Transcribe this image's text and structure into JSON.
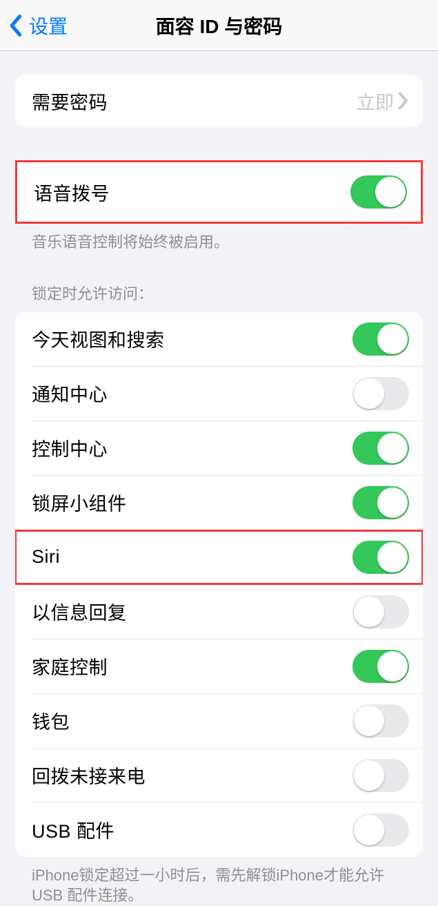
{
  "header": {
    "back_label": "设置",
    "title": "面容 ID 与密码"
  },
  "require_passcode": {
    "label": "需要密码",
    "value": "立即"
  },
  "voice_dial": {
    "label": "语音拨号",
    "on": true,
    "footer": "音乐语音控制将始终被启用。"
  },
  "lock_access_header": "锁定时允许访问：",
  "lock_access_items": [
    {
      "label": "今天视图和搜索",
      "on": true,
      "highlighted": false
    },
    {
      "label": "通知中心",
      "on": false,
      "highlighted": false
    },
    {
      "label": "控制中心",
      "on": true,
      "highlighted": false
    },
    {
      "label": "锁屏小组件",
      "on": true,
      "highlighted": false
    },
    {
      "label": "Siri",
      "on": true,
      "highlighted": true
    },
    {
      "label": "以信息回复",
      "on": false,
      "highlighted": false
    },
    {
      "label": "家庭控制",
      "on": true,
      "highlighted": false
    },
    {
      "label": "钱包",
      "on": false,
      "highlighted": false
    },
    {
      "label": "回拨未接来电",
      "on": false,
      "highlighted": false
    },
    {
      "label": "USB 配件",
      "on": false,
      "highlighted": false
    }
  ],
  "usb_footer": "iPhone锁定超过一小时后，需先解锁iPhone才能允许USB 配件连接。"
}
